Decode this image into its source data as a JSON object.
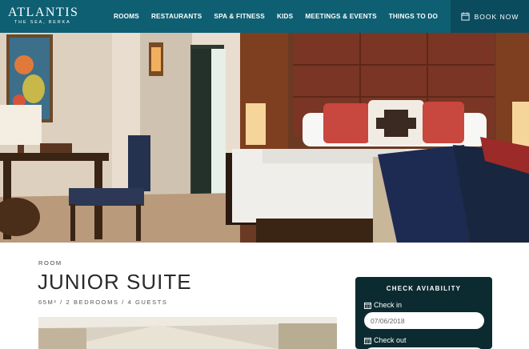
{
  "header": {
    "logo_main": "ATLANTIS",
    "logo_sub": "THE SEA, BERKA",
    "nav": [
      "ROOMS",
      "RESTAURANTS",
      "SPA & FITNESS",
      "KIDS",
      "MEETINGS & EVENTS",
      "THINGS TO DO"
    ],
    "book_label": "BOOK NOW",
    "colors": {
      "bar": "#0f5f73",
      "book_bg": "#0a4c5e"
    }
  },
  "room": {
    "eyebrow": "ROOM",
    "title": "JUNIOR SUITE",
    "meta": "65M² / 2 BEDROOMS / 4 GUESTS"
  },
  "booking": {
    "title": "CHECK AVIABILITY",
    "checkin_label": "Check in",
    "checkin_value": "07/06/2018",
    "checkout_label": "Check out",
    "card_color": "#0c2b31"
  }
}
